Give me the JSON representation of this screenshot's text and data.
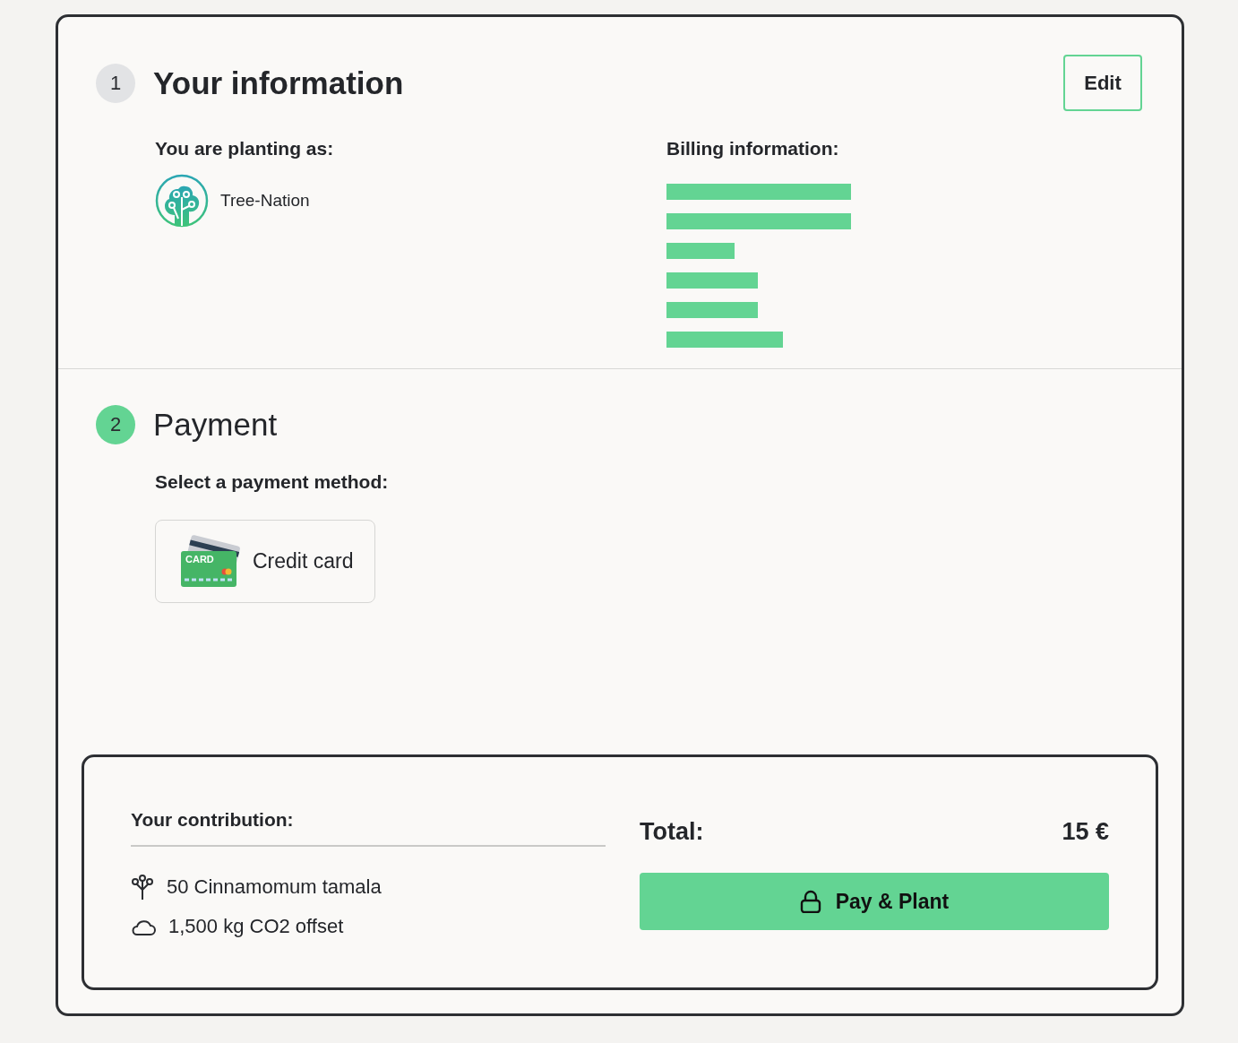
{
  "steps": [
    {
      "number": "1",
      "title": "Your information",
      "active": false
    },
    {
      "number": "2",
      "title": "Payment",
      "active": true
    }
  ],
  "edit_button": "Edit",
  "planting_as": {
    "label": "You are planting as:",
    "name": "Tree-Nation"
  },
  "billing": {
    "label": "Billing information:"
  },
  "payment": {
    "label": "Select a payment method:",
    "methods": [
      {
        "label": "Credit card",
        "card_text": "CARD",
        "selected": false
      }
    ]
  },
  "summary": {
    "label": "Your contribution:",
    "items": [
      {
        "kind": "tree",
        "text": "50 Cinnamomum tamala"
      },
      {
        "kind": "co2",
        "text": "1,500 kg CO2 offset"
      }
    ],
    "total_label": "Total:",
    "total_value": "15 €",
    "pay_button": "Pay & Plant"
  }
}
